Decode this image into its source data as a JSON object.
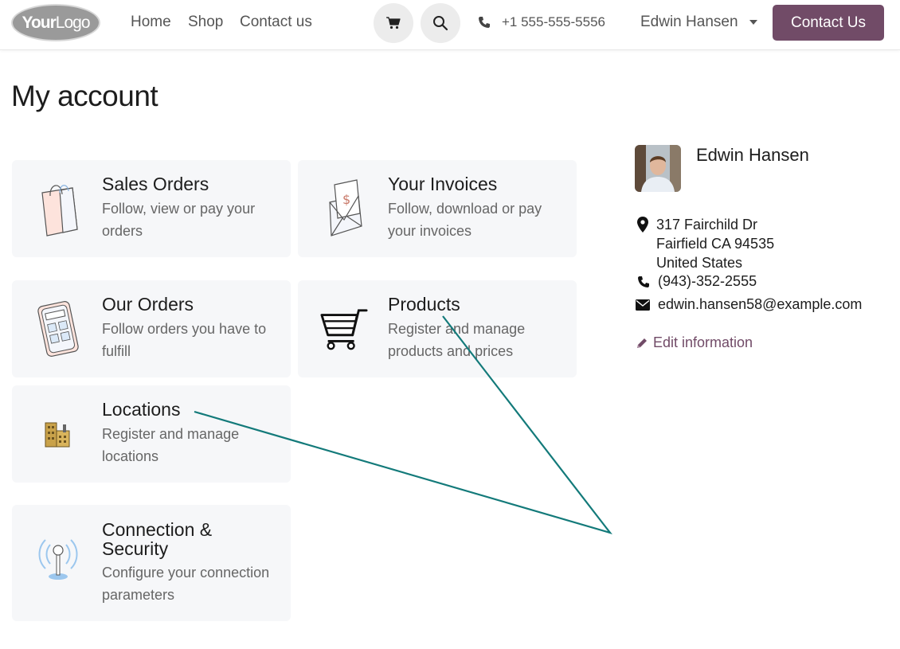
{
  "header": {
    "logo_text_bold": "Your",
    "logo_text_light": "Logo",
    "nav": [
      "Home",
      "Shop",
      "Contact us"
    ],
    "phone": "+1 555-555-5556",
    "user_name": "Edwin Hansen",
    "cta_label": "Contact Us"
  },
  "page_title": "My account",
  "cards": [
    {
      "title": "Sales Orders",
      "desc": "Follow, view or pay your orders",
      "icon": "shopping-bag-icon"
    },
    {
      "title": "Your Invoices",
      "desc": "Follow, download or pay your invoices",
      "icon": "invoice-icon"
    },
    {
      "title": "Our Orders",
      "desc": "Follow orders you have to fulfill",
      "icon": "calculator-icon"
    },
    {
      "title": "Products",
      "desc": "Register and manage products and prices",
      "icon": "shopping-cart-icon"
    },
    {
      "title": "Locations",
      "desc": "Register and manage locations",
      "icon": "warehouse-icon"
    },
    {
      "title": "Connection & Security",
      "desc": "Configure your connection parameters",
      "icon": "antenna-icon"
    }
  ],
  "profile": {
    "name": "Edwin Hansen",
    "address_line1": "317 Fairchild Dr",
    "address_line2": "Fairfield CA 94535",
    "address_line3": "United States",
    "phone": "(943)-352-2555",
    "email": "edwin.hansen58@example.com",
    "edit_label": "Edit information"
  },
  "colors": {
    "brand": "#714b67",
    "card_bg": "#f6f7f9",
    "annotation": "#137a7a"
  }
}
